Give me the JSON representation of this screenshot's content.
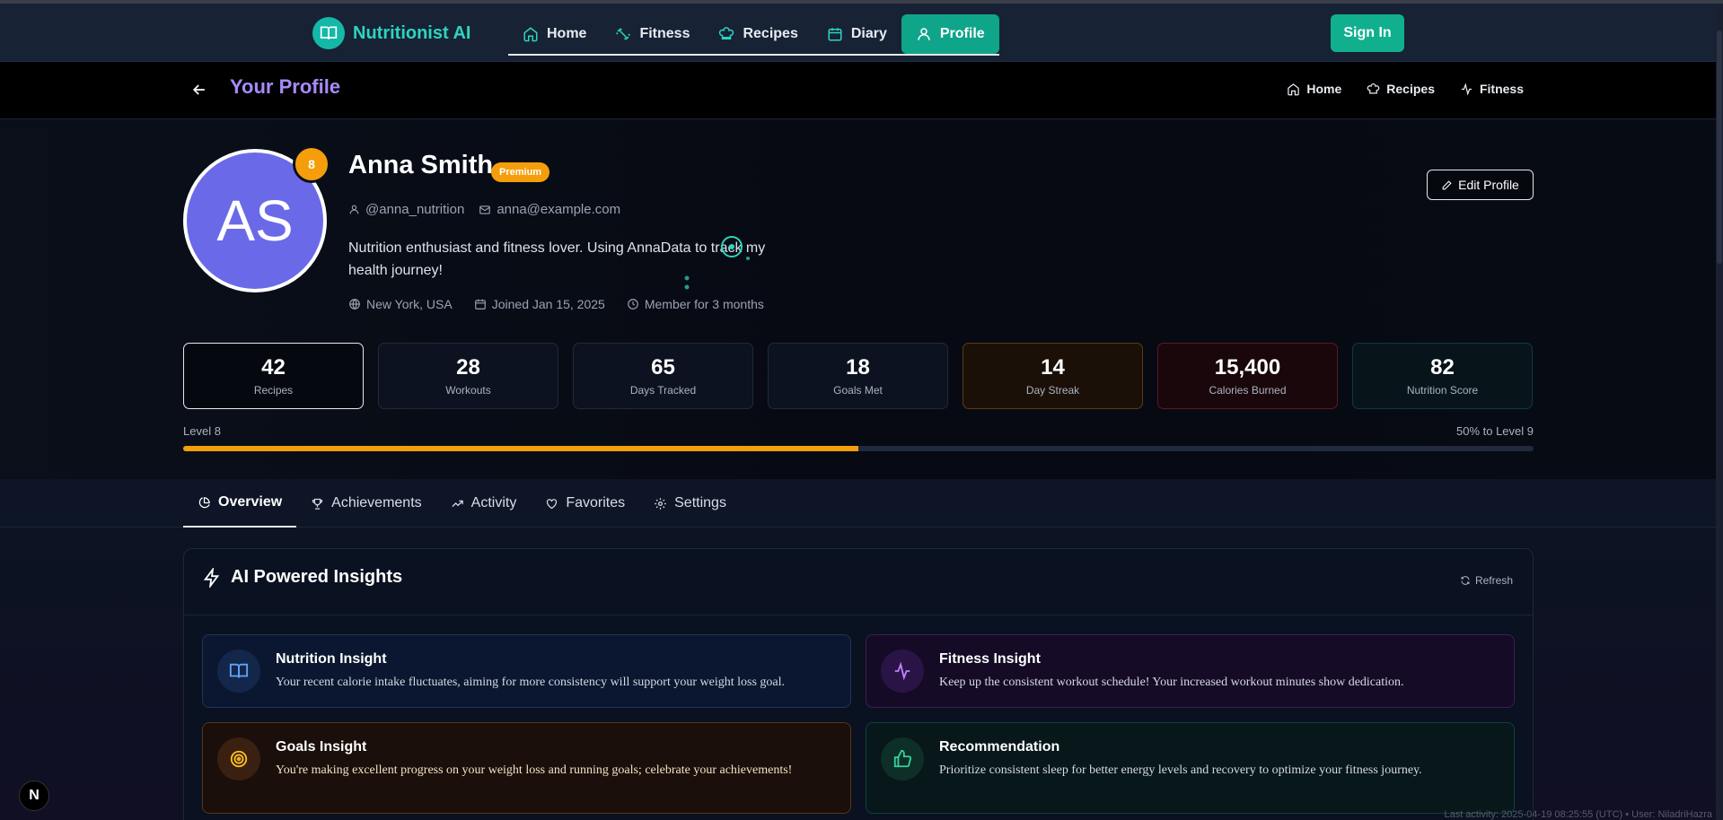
{
  "nav": {
    "brand": "Nutritionist AI",
    "links": [
      {
        "label": "Home",
        "icon": "home-icon"
      },
      {
        "label": "Fitness",
        "icon": "dumbbell-icon"
      },
      {
        "label": "Recipes",
        "icon": "chef-hat-icon"
      },
      {
        "label": "Diary",
        "icon": "calendar-icon"
      },
      {
        "label": "Profile",
        "icon": "user-icon",
        "active": true
      }
    ],
    "sign_in": "Sign In"
  },
  "subheader": {
    "title": "Your Profile",
    "links": [
      {
        "label": "Home",
        "icon": "home-icon"
      },
      {
        "label": "Recipes",
        "icon": "chef-hat-icon"
      },
      {
        "label": "Fitness",
        "icon": "activity-icon"
      }
    ]
  },
  "profile": {
    "initials": "AS",
    "level_badge": "8",
    "name": "Anna Smith",
    "badge": "Premium",
    "username": "@anna_nutrition",
    "email": "anna@example.com",
    "bio": "Nutrition enthusiast and fitness lover. Using AnnaData to track my health journey!",
    "location": "New York, USA",
    "joined": "Joined Jan 15, 2025",
    "member_for": "Member for 3 months",
    "edit_label": "Edit Profile"
  },
  "stats": [
    {
      "value": "42",
      "label": "Recipes"
    },
    {
      "value": "28",
      "label": "Workouts"
    },
    {
      "value": "65",
      "label": "Days Tracked"
    },
    {
      "value": "18",
      "label": "Goals Met"
    },
    {
      "value": "14",
      "label": "Day Streak"
    },
    {
      "value": "15,400",
      "label": "Calories Burned"
    },
    {
      "value": "82",
      "label": "Nutrition Score"
    }
  ],
  "level": {
    "label": "Level 8",
    "next": "50% to Level 9",
    "progress_pct": 50
  },
  "tabs": [
    {
      "label": "Overview",
      "icon": "pie-chart-icon",
      "active": true
    },
    {
      "label": "Achievements",
      "icon": "trophy-icon"
    },
    {
      "label": "Activity",
      "icon": "trending-up-icon"
    },
    {
      "label": "Favorites",
      "icon": "heart-icon"
    },
    {
      "label": "Settings",
      "icon": "gear-icon"
    }
  ],
  "insights": {
    "title": "AI Powered Insights",
    "refresh": "Refresh",
    "items": [
      {
        "title": "Nutrition Insight",
        "text": "Your recent calorie intake fluctuates, aiming for more consistency will support your weight loss goal.",
        "icon": "book-icon"
      },
      {
        "title": "Fitness Insight",
        "text": "Keep up the consistent workout schedule! Your increased workout minutes show dedication.",
        "icon": "pulse-icon"
      },
      {
        "title": "Goals Insight",
        "text": "You're making excellent progress on your weight loss and running goals; celebrate your achievements!",
        "icon": "target-icon"
      },
      {
        "title": "Recommendation",
        "text": "Prioritize consistent sleep for better energy levels and recovery to optimize your fitness journey.",
        "icon": "thumbs-up-icon"
      }
    ]
  },
  "footer": {
    "next_badge": "N",
    "note": "Last activity: 2025-04-19 08:25:55 (UTC) • User: NiladriHazra"
  },
  "colors": {
    "accent": "#10b08e",
    "brand_teal": "#2dd4bf",
    "title_purple": "#a78bfa",
    "premium": "#f59e0b",
    "avatar": "#6a6ae8"
  }
}
